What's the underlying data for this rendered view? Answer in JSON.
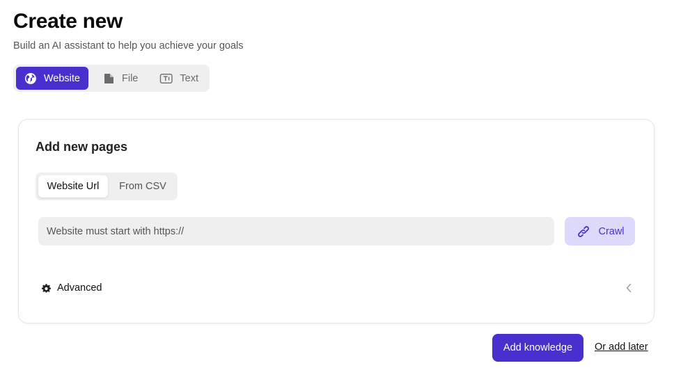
{
  "header": {
    "title": "Create new",
    "subtitle": "Build an AI assistant to help you achieve your goals"
  },
  "source_tabs": {
    "selected": "Website",
    "items": [
      {
        "label": "Website",
        "icon": "globe-icon"
      },
      {
        "label": "File",
        "icon": "file-icon"
      },
      {
        "label": "Text",
        "icon": "text-icon"
      }
    ]
  },
  "card": {
    "title": "Add new pages",
    "mode_tabs": {
      "selected": "Website Url",
      "items": [
        {
          "label": "Website Url"
        },
        {
          "label": "From CSV"
        }
      ]
    },
    "url_input": {
      "value": "",
      "placeholder": "Website must start with https://"
    },
    "crawl_button": {
      "label": "Crawl",
      "icon": "link-icon"
    },
    "advanced": {
      "label": "Advanced",
      "icon": "gear-icon",
      "toggle_icon": "chevron-left-icon"
    }
  },
  "footer": {
    "add_knowledge_label": "Add knowledge",
    "add_later_label": "Or add later"
  },
  "colors": {
    "accent": "#4a2fcf",
    "accent_light": "#ddd9fb",
    "tab_background": "#efefef",
    "input_background": "#efefef"
  }
}
